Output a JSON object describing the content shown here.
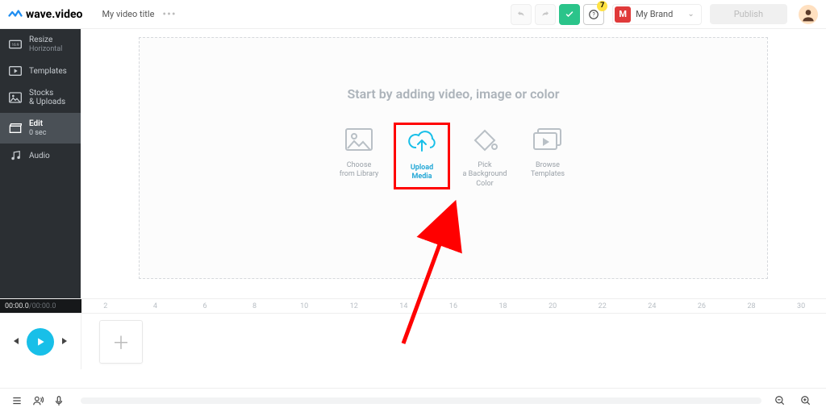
{
  "app": {
    "name": "wave.video"
  },
  "header": {
    "title": "My video title",
    "brand_label": "My Brand",
    "brand_initial": "M",
    "publish_label": "Publish",
    "help_badge": "7"
  },
  "sidebar": {
    "items": [
      {
        "label": "Resize",
        "sub": "Horizontal"
      },
      {
        "label": "Templates"
      },
      {
        "label": "Stocks\n& Uploads"
      },
      {
        "label": "Edit",
        "sub": "0 sec",
        "active": true
      },
      {
        "label": "Audio"
      }
    ]
  },
  "canvas": {
    "prompt": "Start by adding video, image or color",
    "options": [
      {
        "label": "Choose\nfrom Library"
      },
      {
        "label": "Upload\nMedia",
        "highlight": true
      },
      {
        "label": "Pick\na Background\nColor"
      },
      {
        "label": "Browse\nTemplates"
      }
    ]
  },
  "timeline": {
    "current": "00:00.0",
    "total": "00:00.0",
    "ticks": [
      "2",
      "4",
      "6",
      "8",
      "10",
      "12",
      "14",
      "16",
      "18",
      "20",
      "22",
      "24",
      "26",
      "28",
      "30"
    ]
  }
}
